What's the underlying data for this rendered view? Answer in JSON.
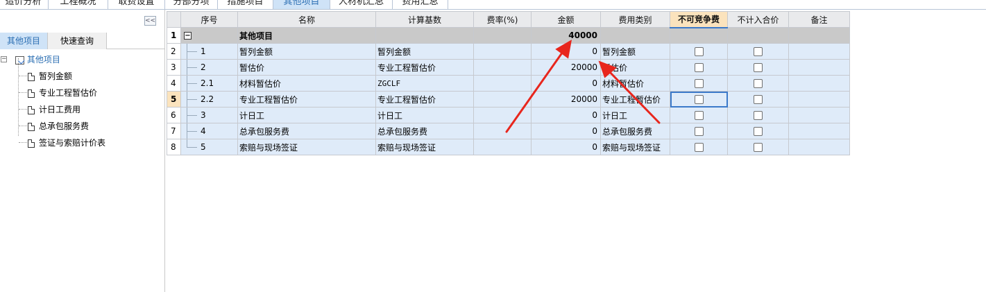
{
  "top_tabs": [
    "造价分析",
    "工程概况",
    "取费设置",
    "分部分项",
    "措施项目",
    "其他项目",
    "人材机汇总",
    "费用汇总"
  ],
  "top_tab_active_index": 5,
  "left_panel": {
    "collapse_glyph": "<<",
    "tabs": [
      "其他项目",
      "快速查询"
    ],
    "active_tab_index": 0,
    "tree": {
      "root": "其他项目",
      "children": [
        "暂列金额",
        "专业工程暂估价",
        "计日工费用",
        "总承包服务费",
        "签证与索赔计价表"
      ]
    }
  },
  "grid": {
    "headers": [
      "序号",
      "名称",
      "计算基数",
      "费率(%)",
      "金额",
      "费用类别",
      "不可竞争费",
      "不计入合价",
      "备注"
    ],
    "highlighted_header_index": 6,
    "current_row_number": "5",
    "rows": [
      {
        "rn": "1",
        "seq": "",
        "name": "其他项目",
        "base": "",
        "rate": "",
        "amount": "40000",
        "category": "",
        "group": true
      },
      {
        "rn": "2",
        "seq": "1",
        "name": "暂列金额",
        "base": "暂列金额",
        "rate": "",
        "amount": "0",
        "category": "暂列金额"
      },
      {
        "rn": "3",
        "seq": "2",
        "name": "暂估价",
        "base": "专业工程暂估价",
        "rate": "",
        "amount": "20000",
        "category": "暂估价"
      },
      {
        "rn": "4",
        "seq": "2.1",
        "name": "材料暂估价",
        "base": "ZGCLF",
        "rate": "",
        "amount": "0",
        "category": "材料暂估价"
      },
      {
        "rn": "5",
        "seq": "2.2",
        "name": "专业工程暂估价",
        "base": "专业工程暂估价",
        "rate": "",
        "amount": "20000",
        "category": "专业工程暂估价"
      },
      {
        "rn": "6",
        "seq": "3",
        "name": "计日工",
        "base": "计日工",
        "rate": "",
        "amount": "0",
        "category": "计日工"
      },
      {
        "rn": "7",
        "seq": "4",
        "name": "总承包服务费",
        "base": "总承包服务费",
        "rate": "",
        "amount": "0",
        "category": "总承包服务费"
      },
      {
        "rn": "8",
        "seq": "5",
        "name": "索赔与现场签证",
        "base": "索赔与现场签证",
        "rate": "",
        "amount": "0",
        "category": "索赔与现场签证"
      }
    ]
  },
  "colors": {
    "active_tab_bg": "#cfe3f7",
    "row_bg": "#dfebf9",
    "group_row_bg": "#c9c9c9",
    "header_highlight_bg": "#fbe3bd",
    "arrow": "#e8261d"
  }
}
